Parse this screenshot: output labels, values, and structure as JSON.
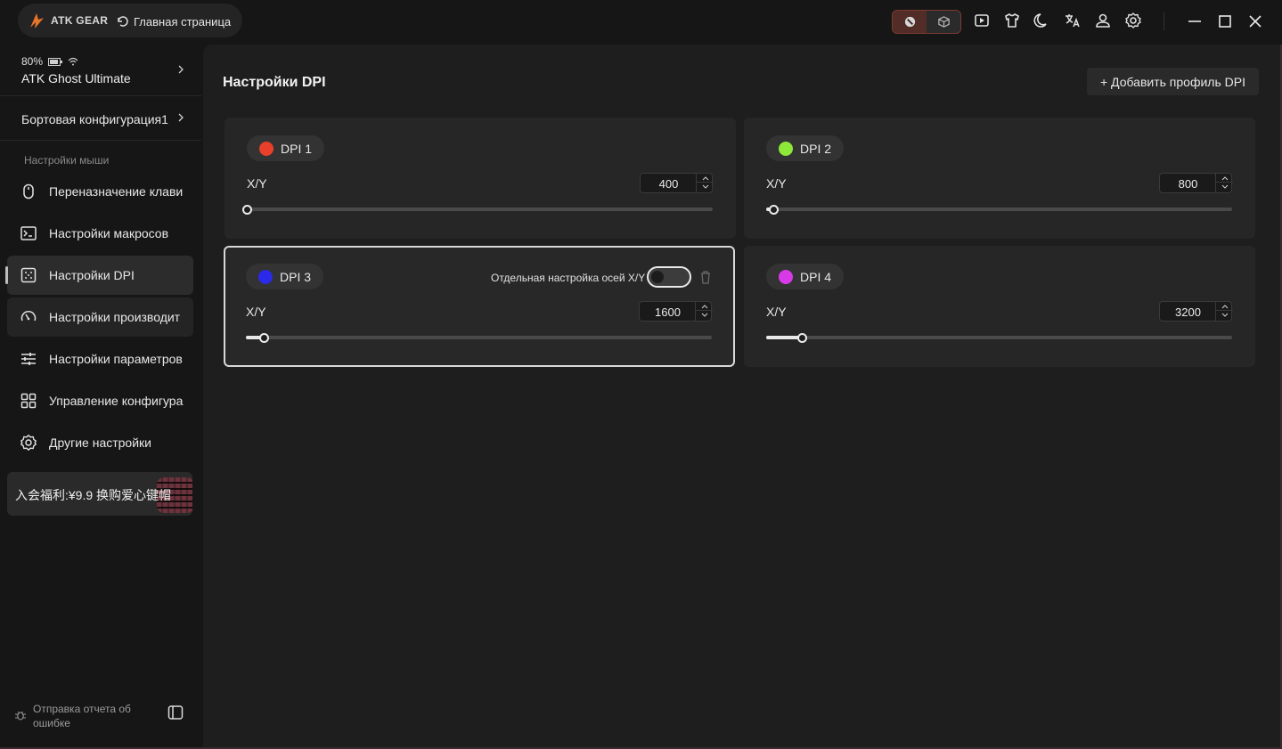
{
  "titlebar": {
    "brand": "ATK GEAR",
    "home_label": "Главная страница"
  },
  "sidebar": {
    "battery": "80%",
    "device_name": "ATK Ghost Ultimate",
    "onboard_config": "Бортовая конфигурация1",
    "section_label": "Настройки мыши",
    "items": [
      {
        "label": "Переназначение клави",
        "icon": "mouse-icon"
      },
      {
        "label": "Настройки макросов",
        "icon": "terminal-icon"
      },
      {
        "label": "Настройки DPI",
        "icon": "dpi-icon",
        "active": true
      },
      {
        "label": "Настройки производит",
        "icon": "gauge-icon"
      },
      {
        "label": "Настройки параметров",
        "icon": "sliders-icon"
      },
      {
        "label": "Управление конфигура",
        "icon": "grid-icon"
      },
      {
        "label": "Другие настройки",
        "icon": "gear-icon"
      }
    ],
    "promo": "入会福利:¥9.9 换购爱心键帽",
    "bug_report": "Отправка отчета об ошибке"
  },
  "main": {
    "title": "Настройки DPI",
    "add_profile": "+ Добавить профиль DPI",
    "axis_label": "X/Y",
    "split_axes_label": "Отдельная настройка осей X/Y",
    "dpi_cards": [
      {
        "name": "DPI 1",
        "color": "#e8402a",
        "value": "400",
        "slider_value": 0.0
      },
      {
        "name": "DPI 2",
        "color": "#8ee83a",
        "value": "800",
        "slider_value": 0.015
      },
      {
        "name": "DPI 3",
        "color": "#2a2ae8",
        "value": "1600",
        "slider_value": 0.038,
        "selected": true
      },
      {
        "name": "DPI 4",
        "color": "#d83ae8",
        "value": "3200",
        "slider_value": 0.077
      }
    ]
  },
  "colors": {
    "accent_border": "#7a3a30"
  }
}
